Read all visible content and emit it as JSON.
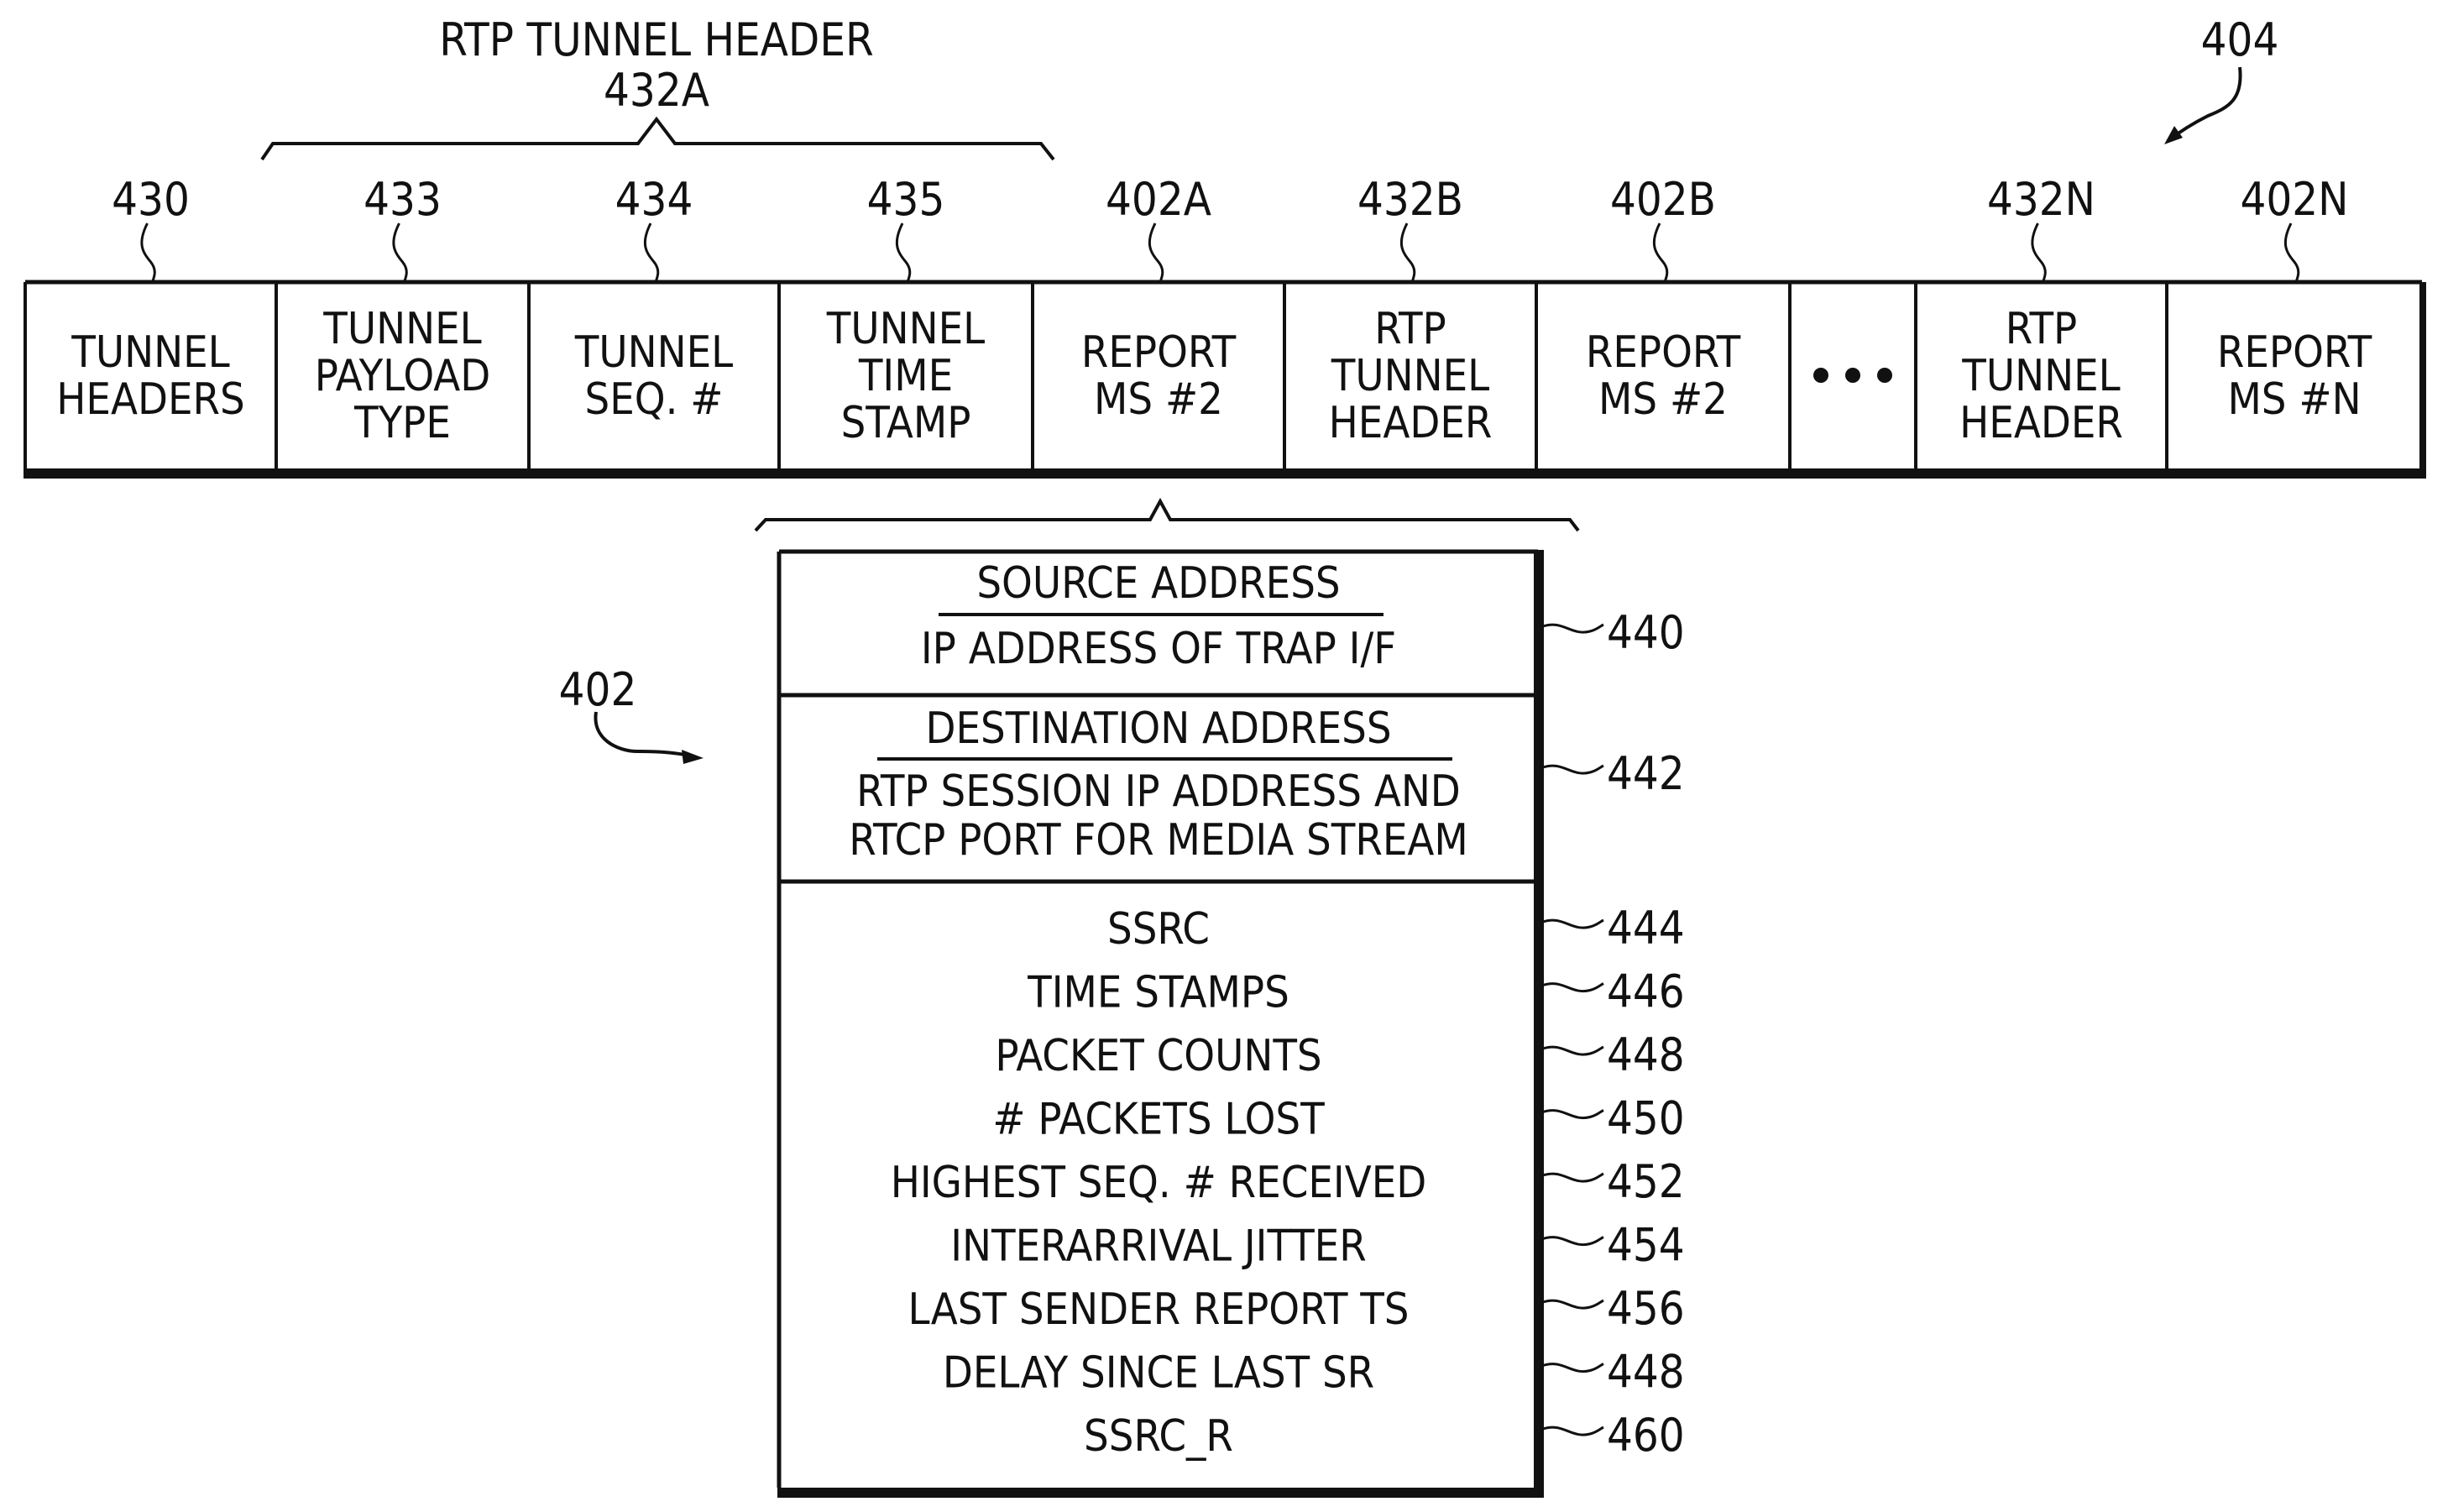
{
  "figure": {
    "title": "RTP TUNNEL HEADER",
    "title_ref": "432A",
    "packet_ref": "404",
    "report_ref": "402"
  },
  "packet": {
    "cells": [
      {
        "ref": "430",
        "lines": [
          "TUNNEL",
          "HEADERS"
        ]
      },
      {
        "ref": "433",
        "lines": [
          "TUNNEL",
          "PAYLOAD",
          "TYPE"
        ]
      },
      {
        "ref": "434",
        "lines": [
          "TUNNEL",
          "SEQ. #"
        ]
      },
      {
        "ref": "435",
        "lines": [
          "TUNNEL",
          "TIME",
          "STAMP"
        ]
      },
      {
        "ref": "402A",
        "lines": [
          "REPORT",
          "MS #2"
        ]
      },
      {
        "ref": "432B",
        "lines": [
          "RTP",
          "TUNNEL",
          "HEADER"
        ]
      },
      {
        "ref": "402B",
        "lines": [
          "REPORT",
          "MS #2"
        ]
      },
      {
        "ref": "",
        "lines": [],
        "ellipsis": true
      },
      {
        "ref": "432N",
        "lines": [
          "RTP",
          "TUNNEL",
          "HEADER"
        ]
      },
      {
        "ref": "402N",
        "lines": [
          "REPORT",
          "MS #N"
        ]
      }
    ]
  },
  "report": {
    "source": {
      "heading": "SOURCE ADDRESS",
      "value": "IP ADDRESS OF TRAP I/F",
      "ref": "440"
    },
    "destination": {
      "heading": "DESTINATION ADDRESS",
      "value_lines": [
        "RTP SESSION IP ADDRESS AND",
        "RTCP PORT FOR MEDIA STREAM"
      ],
      "ref": "442"
    },
    "fields": [
      {
        "label": "SSRC",
        "ref": "444"
      },
      {
        "label": "TIME STAMPS",
        "ref": "446"
      },
      {
        "label": "PACKET COUNTS",
        "ref": "448"
      },
      {
        "label": "# PACKETS LOST",
        "ref": "450"
      },
      {
        "label": "HIGHEST SEQ. # RECEIVED",
        "ref": "452"
      },
      {
        "label": "INTERARRIVAL JITTER",
        "ref": "454"
      },
      {
        "label": "LAST SENDER REPORT TS",
        "ref": "456"
      },
      {
        "label": "DELAY SINCE LAST SR",
        "ref": "448"
      },
      {
        "label": "SSRC_R",
        "ref": "460"
      }
    ]
  }
}
